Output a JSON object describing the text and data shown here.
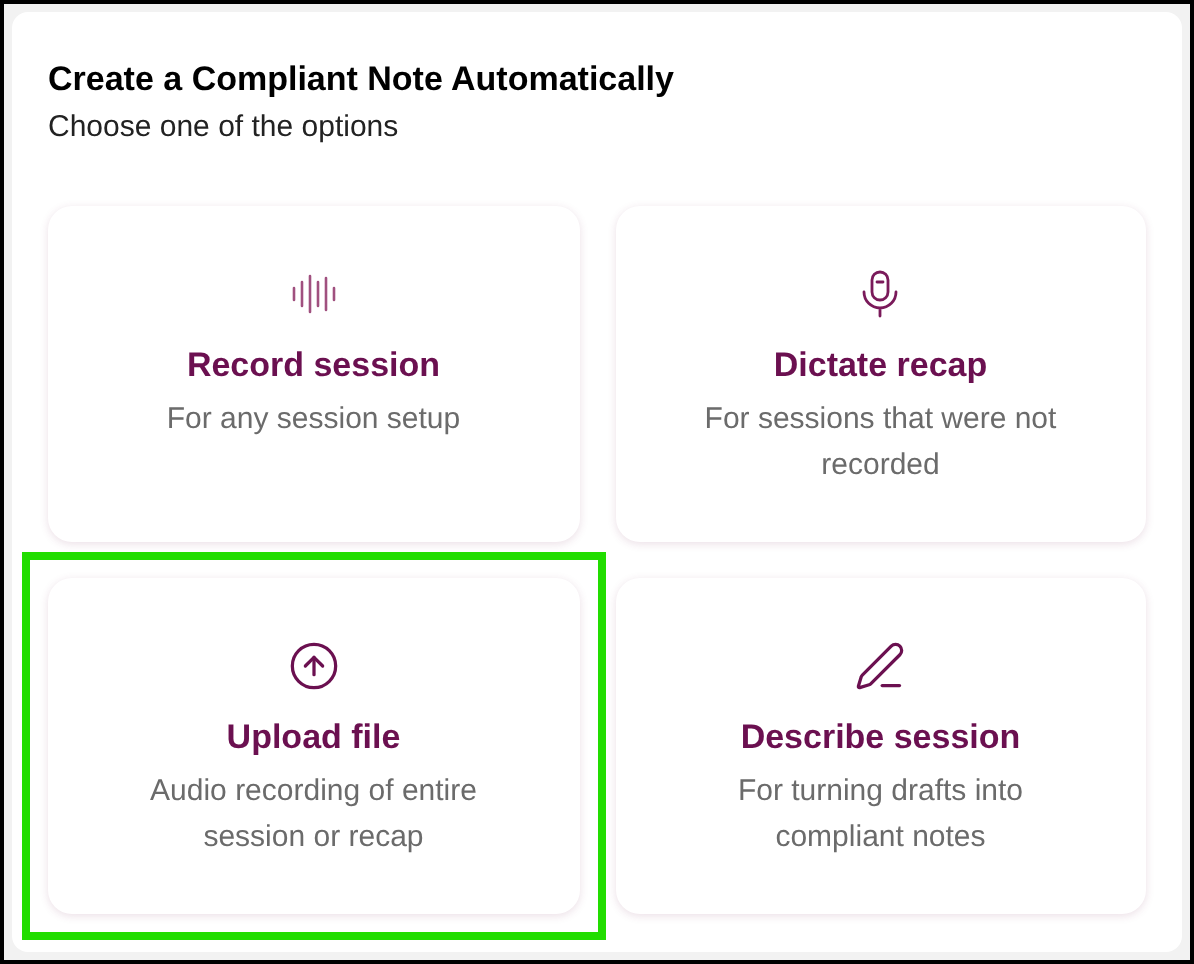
{
  "header": {
    "title": "Create a Compliant Note Automatically",
    "subtitle": "Choose one of the options"
  },
  "options": [
    {
      "kind": "record",
      "title": "Record session",
      "description": "For any session setup",
      "selected": false
    },
    {
      "kind": "dictate",
      "title": "Dictate recap",
      "description": "For sessions that were not recorded",
      "selected": false
    },
    {
      "kind": "upload",
      "title": "Upload file",
      "description": "Audio recording of entire session or recap",
      "selected": true
    },
    {
      "kind": "describe",
      "title": "Describe session",
      "description": "For turning drafts into compliant notes",
      "selected": false
    }
  ]
}
